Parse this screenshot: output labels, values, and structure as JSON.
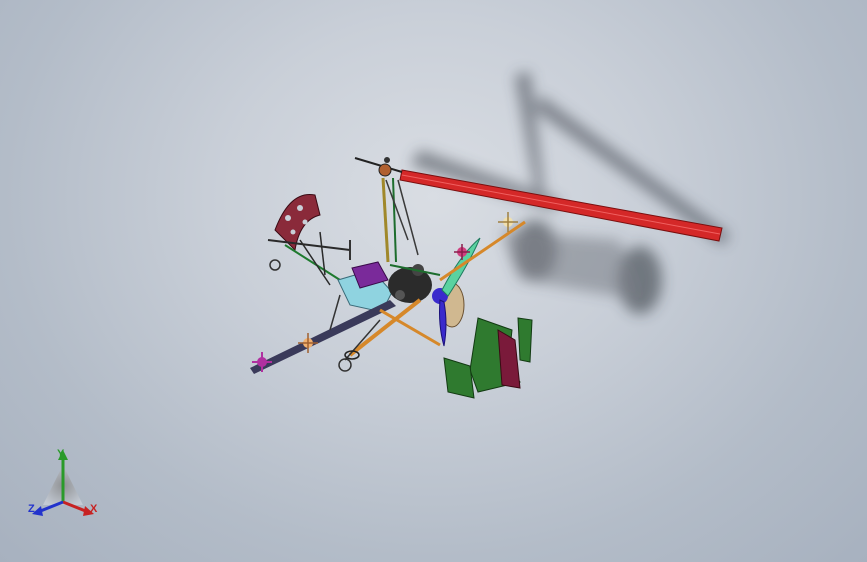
{
  "scene": {
    "model": "gyrocopter-assembly"
  },
  "triad": {
    "x_label": "X",
    "y_label": "Y",
    "z_label": "Z"
  },
  "colors": {
    "rotor_blade": "#d42828",
    "mast": "#a0882a",
    "tail_fin": "#2f7a2f",
    "rudder": "#7a1a3a",
    "propeller": "#5ad2a0",
    "fuel_tank": "#8fd3e0",
    "keel": "#3a3a5a",
    "axis_x": "#c72222",
    "axis_y": "#2a9a2a",
    "axis_z": "#2233cc"
  }
}
